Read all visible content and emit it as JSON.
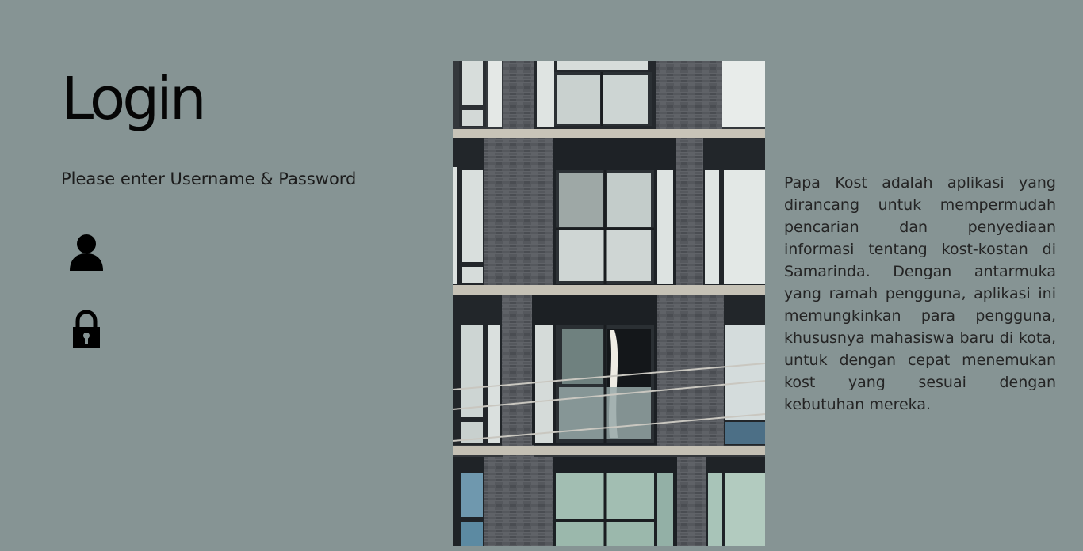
{
  "login": {
    "title": "Login",
    "subtitle": "Please enter Username & Password",
    "username": {
      "icon": "user-icon",
      "value": "",
      "placeholder": ""
    },
    "password": {
      "icon": "lock-icon",
      "value": "",
      "placeholder": ""
    }
  },
  "photo": {
    "subject": "apartment building facade with windows and brick columns"
  },
  "description": "Papa Kost adalah aplikasi yang dirancang untuk mempermudah pencarian dan penyediaan informasi tentang kost-kostan di Samarinda. Dengan antarmuka yang ramah pengguna, aplikasi ini memungkinkan para pengguna, khususnya mahasiswa baru di kota, untuk dengan cepat menemukan kost yang sesuai dengan kebutuhan mereka.",
  "colors": {
    "background": "#869494",
    "text": "#1d1d1d",
    "icon": "#000000"
  }
}
